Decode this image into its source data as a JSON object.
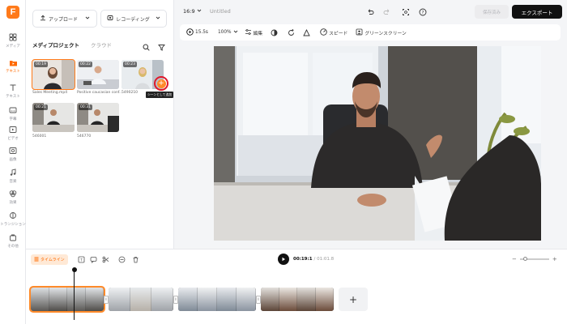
{
  "app": {
    "logo_letter": "F",
    "accent": "#ff7a1a"
  },
  "rail": [
    {
      "label": "メディア",
      "icon": "grid-icon"
    },
    {
      "label": "テキスト",
      "icon": "text-icon"
    },
    {
      "label": "字幕",
      "icon": "caption-icon"
    },
    {
      "label": "ビデオ",
      "icon": "video-icon"
    },
    {
      "label": "画像",
      "icon": "image-icon"
    },
    {
      "label": "音楽",
      "icon": "music-icon"
    },
    {
      "label": "効果",
      "icon": "effects-icon"
    },
    {
      "label": "トランジション",
      "icon": "transition-icon"
    },
    {
      "label": "その他",
      "icon": "bag-icon"
    }
  ],
  "panel": {
    "upload_label": "アップロード",
    "record_label": "レコーディング",
    "tabs": [
      "メディプロジェクト",
      "クラウド"
    ],
    "add_tooltip": "シーンとして追加",
    "media": [
      {
        "duration": "00:19",
        "name": "Sales Meeting.mp4"
      },
      {
        "duration": "00:22",
        "name": "Positive caucasian conf..."
      },
      {
        "duration": "00:23",
        "name": "5490210"
      },
      {
        "duration": "00:21",
        "name": "546001"
      },
      {
        "duration": "00:31",
        "name": "546770"
      }
    ]
  },
  "topbar": {
    "ratio": "16:9",
    "title": "Untitled",
    "save_label": "保存済み",
    "export_label": "エクスポート"
  },
  "toolbar": {
    "duration": "15.5s",
    "zoom": "100%",
    "edit_label": "編集",
    "speed_label": "スピード",
    "greenscreen_label": "グリーンスクリーン"
  },
  "timeline": {
    "badge": "タイムライン",
    "current": "00:19:1",
    "total": "/ 01:01.8"
  }
}
